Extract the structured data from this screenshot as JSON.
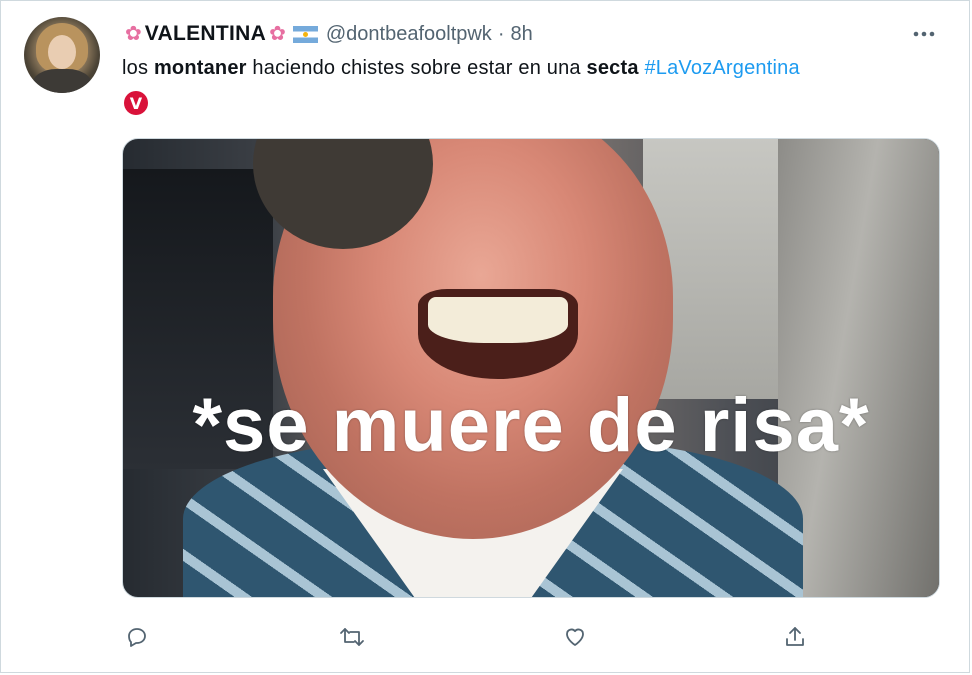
{
  "tweet": {
    "display_name": "VALENTINA",
    "handle": "@dontbeafooltpwk",
    "separator": "·",
    "time": "8h",
    "text": {
      "part1": "los ",
      "bold1": "montaner",
      "part2": " haciendo chistes sobre estar en una ",
      "bold2": "secta",
      "space": " ",
      "hashtag": "#LaVozArgentina"
    },
    "emoji_badge": "V"
  },
  "media": {
    "caption": "*se muere de risa*"
  },
  "icons": {
    "more": "more-icon",
    "reply": "reply-icon",
    "retweet": "retweet-icon",
    "like": "like-icon",
    "share": "share-icon"
  },
  "colors": {
    "text": "#0f1419",
    "secondary": "#536471",
    "link": "#1d9bf0",
    "border": "#cfd9de"
  }
}
